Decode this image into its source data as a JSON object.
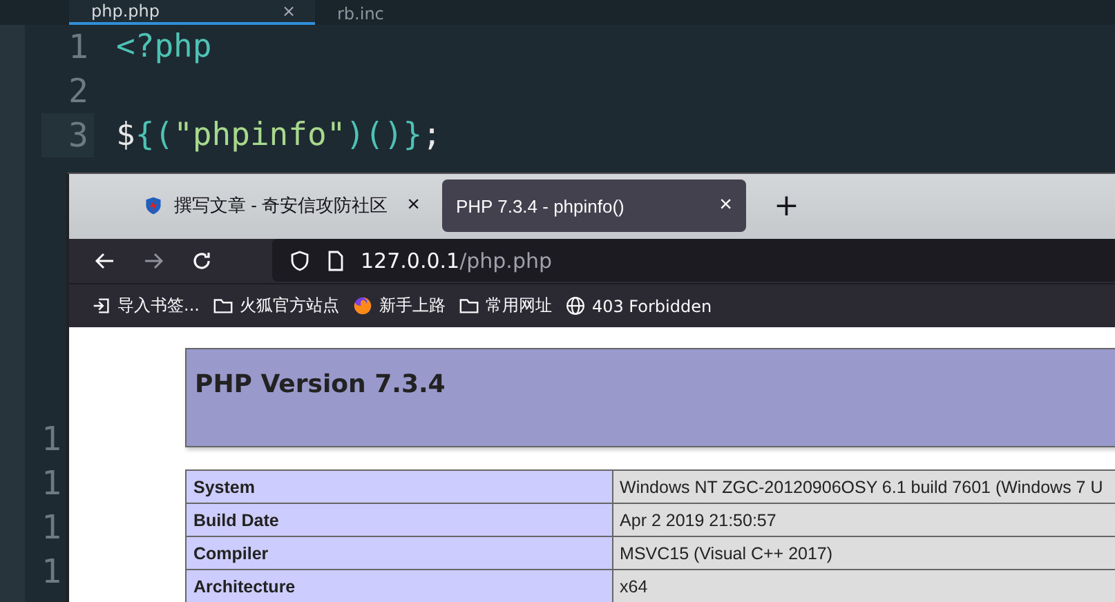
{
  "editor": {
    "tabs": [
      {
        "label": "php.php",
        "selected": true,
        "close": "×"
      },
      {
        "label": "rb.inc",
        "selected": false
      }
    ],
    "lines": [
      {
        "number": "1",
        "tokens": [
          {
            "kind": "tag",
            "text": "<?php"
          }
        ]
      },
      {
        "number": "2"
      },
      {
        "number": "3",
        "tokens": [
          {
            "kind": "var",
            "text": "$"
          },
          {
            "kind": "punct",
            "text": "{("
          },
          {
            "kind": "string",
            "text": "\"phpinfo\""
          },
          {
            "kind": "punct",
            "text": ")()}"
          },
          {
            "kind": "plain",
            "text": ";"
          }
        ]
      }
    ],
    "hidden_line_numbers": [
      "1",
      "1",
      "1",
      "1"
    ]
  },
  "browser": {
    "tabs": [
      {
        "label": "撰写文章 - 奇安信攻防社区",
        "selected": false,
        "close": "×"
      },
      {
        "label": "PHP 7.3.4 - phpinfo()",
        "selected": true,
        "close": "×"
      }
    ],
    "new_tab": "+",
    "url": {
      "host": "127.0.0.1",
      "path": "/php.php"
    },
    "bookmarks": [
      {
        "kind": "import",
        "label": "导入书签..."
      },
      {
        "kind": "folder",
        "label": "火狐官方站点"
      },
      {
        "kind": "fox",
        "label": "新手上路"
      },
      {
        "kind": "folder",
        "label": "常用网址"
      },
      {
        "kind": "globe",
        "label": "403 Forbidden"
      }
    ],
    "page": {
      "title": "PHP Version 7.3.4",
      "rows": [
        {
          "label": "System",
          "value": "Windows NT ZGC-20120906OSY 6.1 build 7601 (Windows 7 U"
        },
        {
          "label": "Build Date",
          "value": "Apr 2 2019 21:50:57"
        },
        {
          "label": "Compiler",
          "value": "MSVC15 (Visual C++ 2017)"
        },
        {
          "label": "Architecture",
          "value": "x64"
        }
      ]
    }
  }
}
